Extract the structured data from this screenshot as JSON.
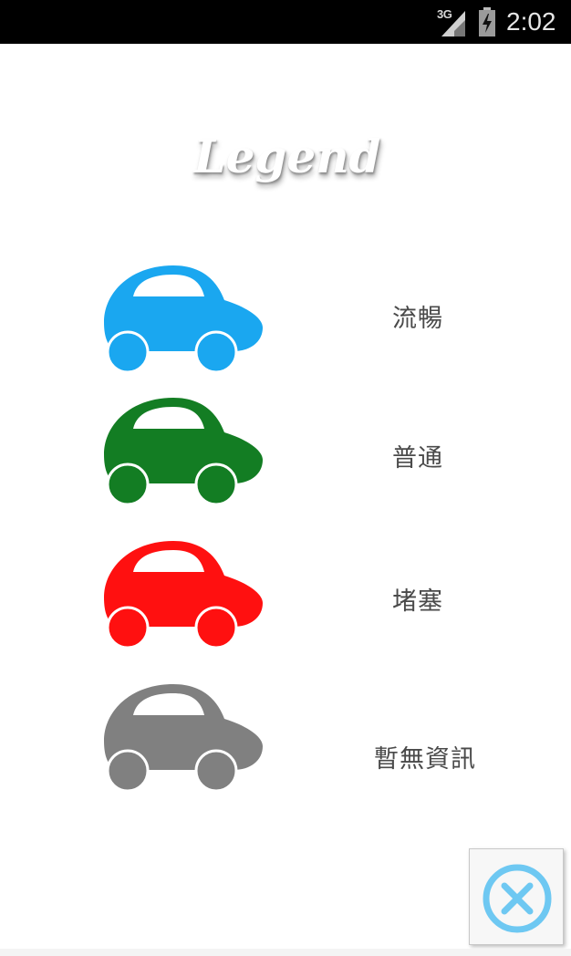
{
  "status_bar": {
    "network": "3G",
    "time": "2:02",
    "icons": [
      "signal-icon",
      "battery-charging-icon"
    ]
  },
  "title": "Legend",
  "legend": [
    {
      "label": "流暢",
      "color": "#1aa7f0",
      "icon": "car-icon"
    },
    {
      "label": "普通",
      "color": "#137d23",
      "icon": "car-icon"
    },
    {
      "label": "堵塞",
      "color": "#ff1010",
      "icon": "car-icon"
    },
    {
      "label": "暫無資訊",
      "color": "#808080",
      "icon": "car-icon"
    }
  ],
  "close_button": {
    "icon": "close-icon",
    "color": "#6ec8f2"
  }
}
